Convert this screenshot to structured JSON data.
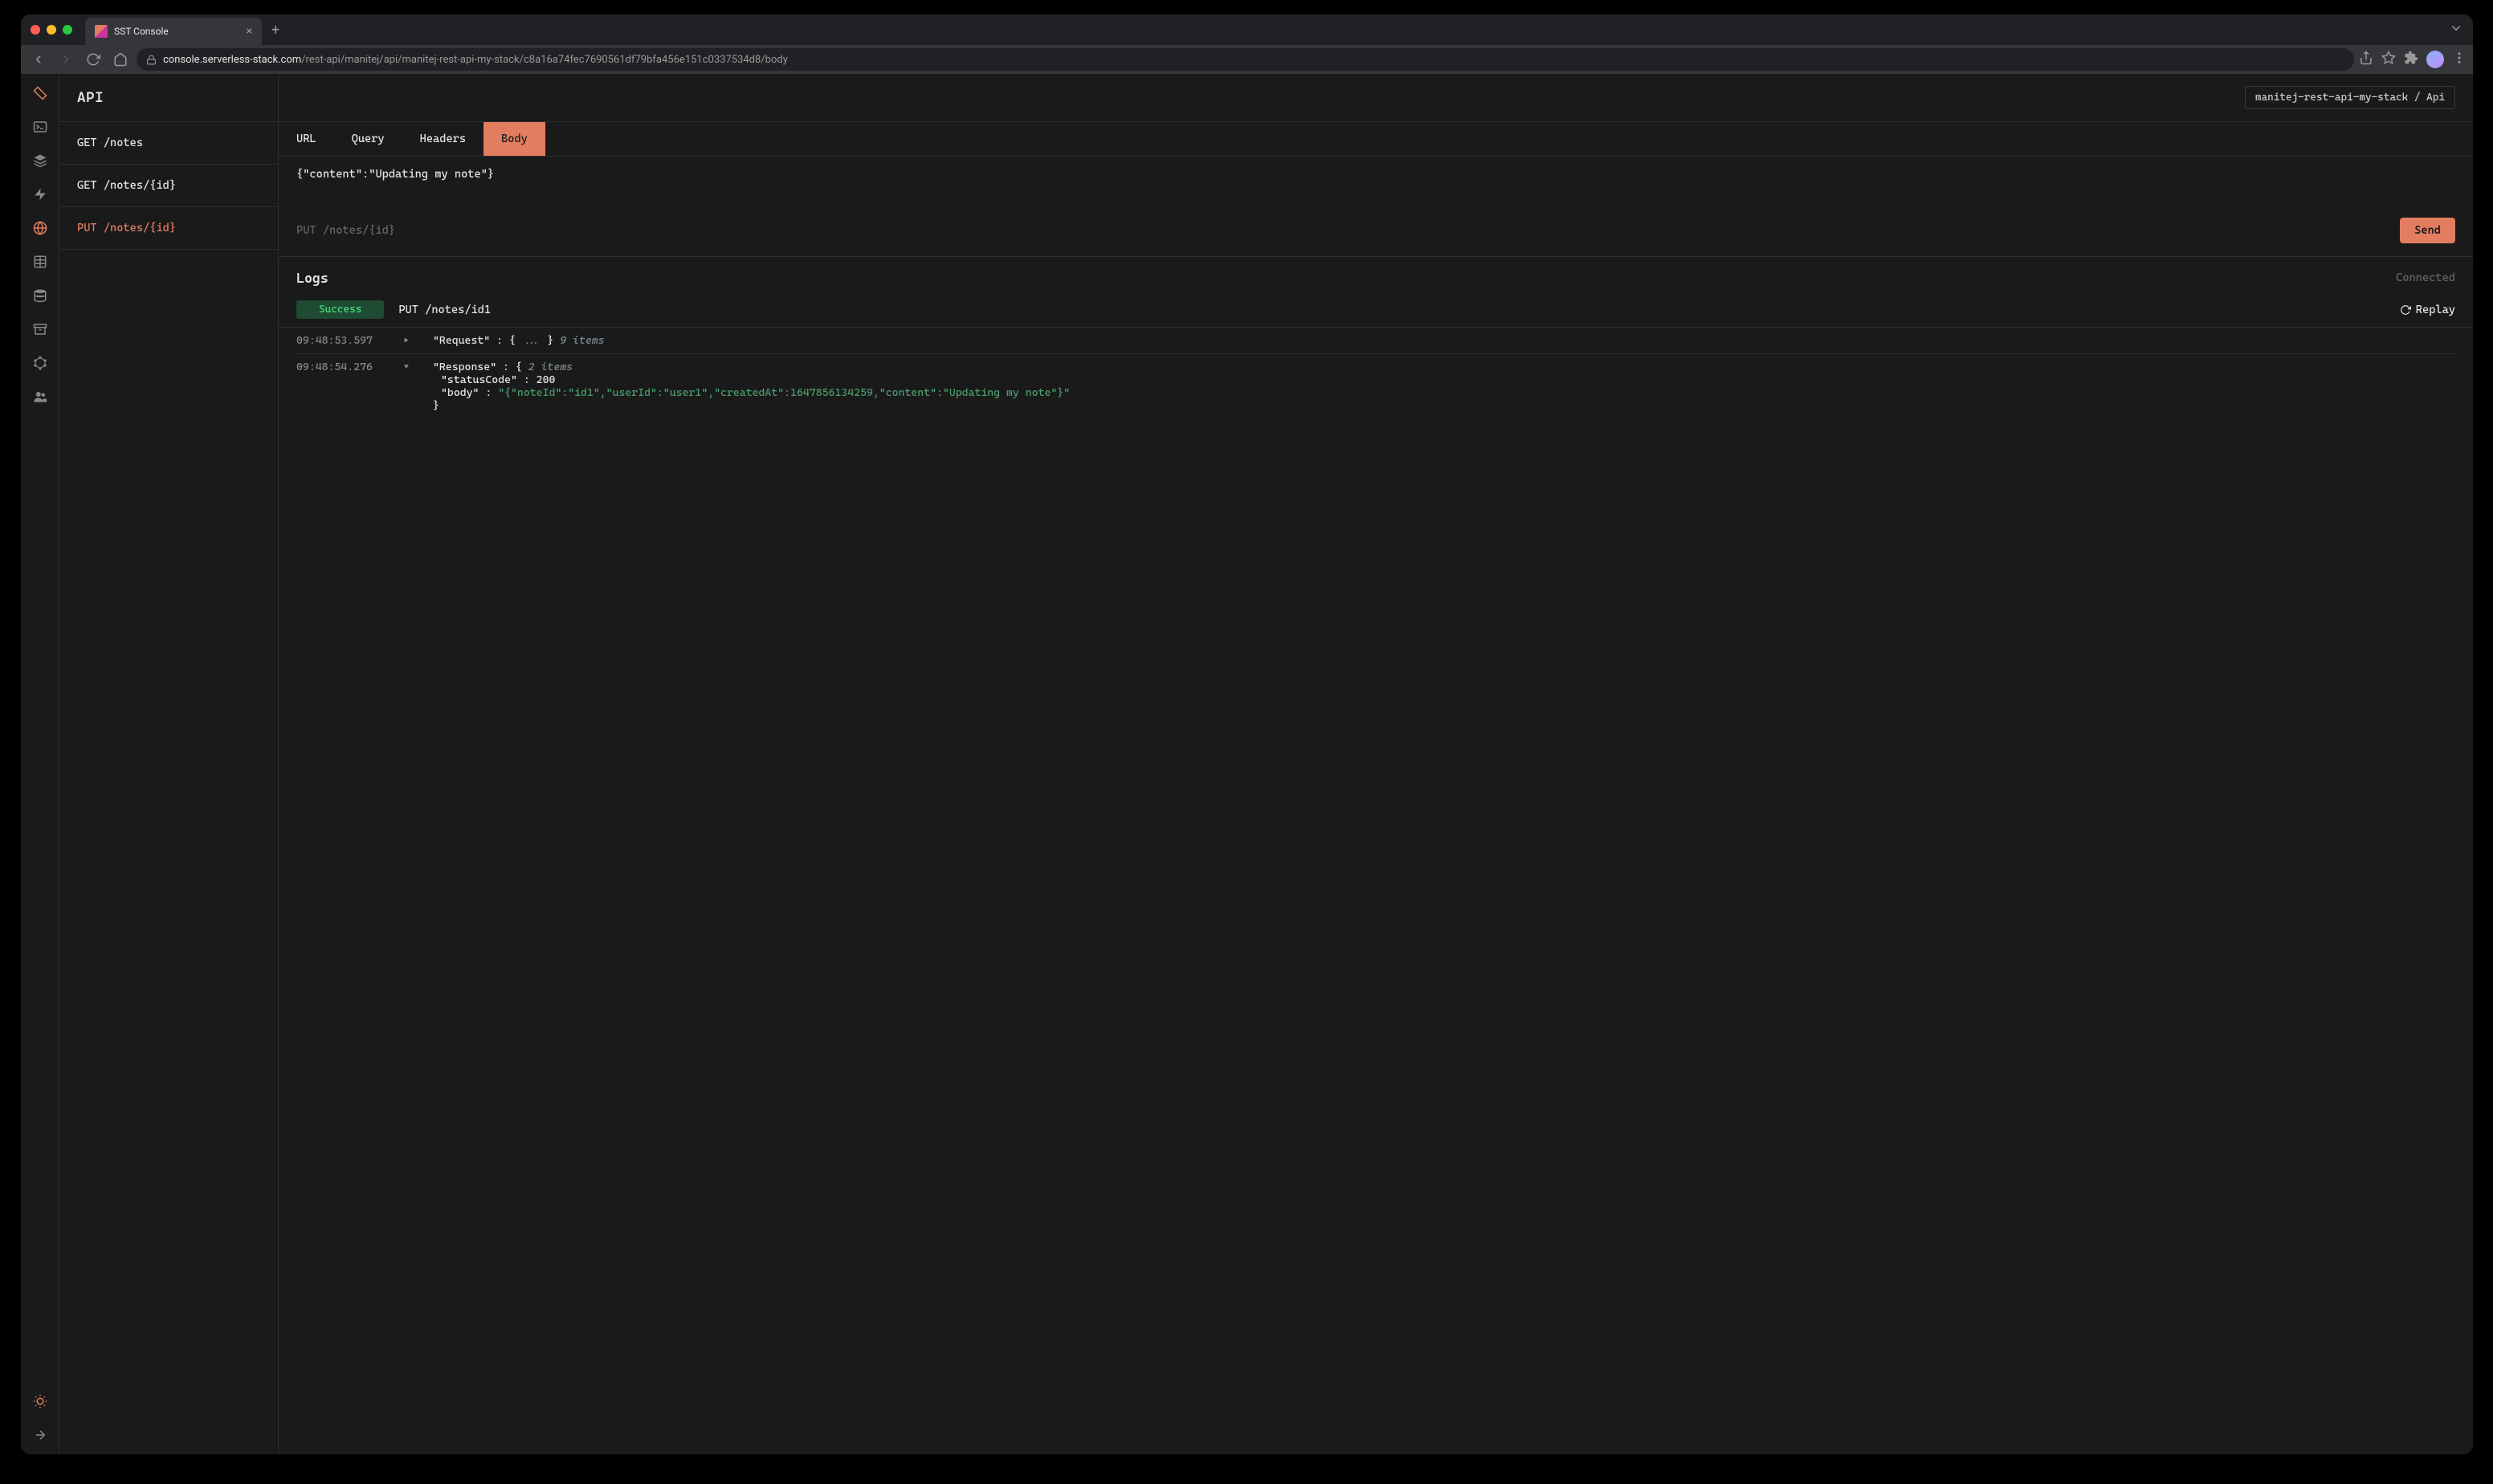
{
  "browser": {
    "tab_title": "SST Console",
    "url_domain": "console.serverless-stack.com",
    "url_path": "/rest-api/manitej/api/manitej-rest-api-my-stack/c8a16a74fec7690561df79bfa456e151c0337534d8/body"
  },
  "header": {
    "title": "API",
    "breadcrumb": "manitej-rest-api-my-stack / Api"
  },
  "endpoints": [
    {
      "label": "GET /notes",
      "active": false
    },
    {
      "label": "GET /notes/{id}",
      "active": false
    },
    {
      "label": "PUT /notes/{id}",
      "active": true
    }
  ],
  "tabs": [
    {
      "label": "URL",
      "active": false
    },
    {
      "label": "Query",
      "active": false
    },
    {
      "label": "Headers",
      "active": false
    },
    {
      "label": "Body",
      "active": true
    }
  ],
  "body_content": "{\"content\":\"Updating my note\"}",
  "request_line": "PUT /notes/{id}",
  "send_label": "Send",
  "logs": {
    "title": "Logs",
    "status": "Connected",
    "badge": "Success",
    "route": "PUT /notes/id1",
    "replay_label": "Replay",
    "entries": [
      {
        "time": "09:48:53.597",
        "expanded": false,
        "label": "\"Request\"",
        "items_count": "9 items"
      },
      {
        "time": "09:48:54.276",
        "expanded": true,
        "label": "\"Response\"",
        "items_count": "2 items",
        "statusCode": "200",
        "body": "\"{\"noteId\":\"id1\",\"userId\":\"user1\",\"createdAt\":1647856134259,\"content\":\"Updating my note\"}\""
      }
    ]
  }
}
